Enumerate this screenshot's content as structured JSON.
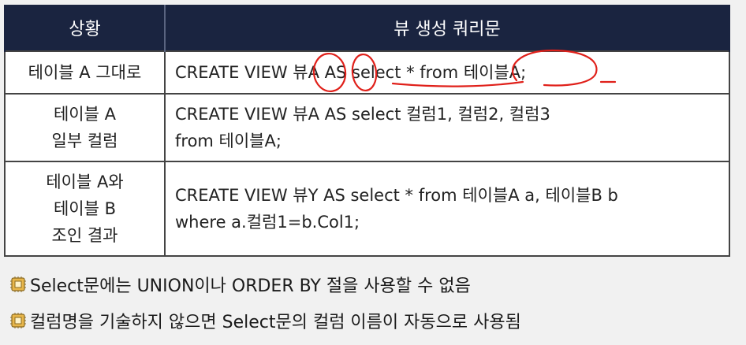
{
  "table": {
    "headers": [
      "상황",
      "뷰 생성 쿼리문"
    ],
    "rows": [
      {
        "situation": [
          "테이블 A 그대로"
        ],
        "query": [
          "CREATE VIEW 뷰A AS select * from 테이블A;"
        ]
      },
      {
        "situation": [
          "테이블 A",
          "일부 컬럼"
        ],
        "query": [
          "CREATE VIEW 뷰A AS select 컬럼1, 컬럼2, 컬럼3",
          "from 테이블A;"
        ]
      },
      {
        "situation": [
          "테이블 A와",
          "테이블 B",
          "조인 결과"
        ],
        "query": [
          "CREATE VIEW 뷰Y AS select * from 테이블A a, 테이블B b",
          "where a.컬럼1=b.Col1;"
        ]
      }
    ]
  },
  "notes": [
    {
      "icon": "chip-bullet-icon",
      "text": "Select문에는 UNION이나 ORDER BY 절을 사용할 수 없음"
    },
    {
      "icon": "chip-bullet-icon",
      "text": "컬럼명을 기술하지 않으면 Select문의 컬럼 이름이 자동으로 사용됨"
    }
  ],
  "colors": {
    "header_bg": "#1a2440",
    "annotation": "#e0201a",
    "background": "#f1f1f1"
  }
}
